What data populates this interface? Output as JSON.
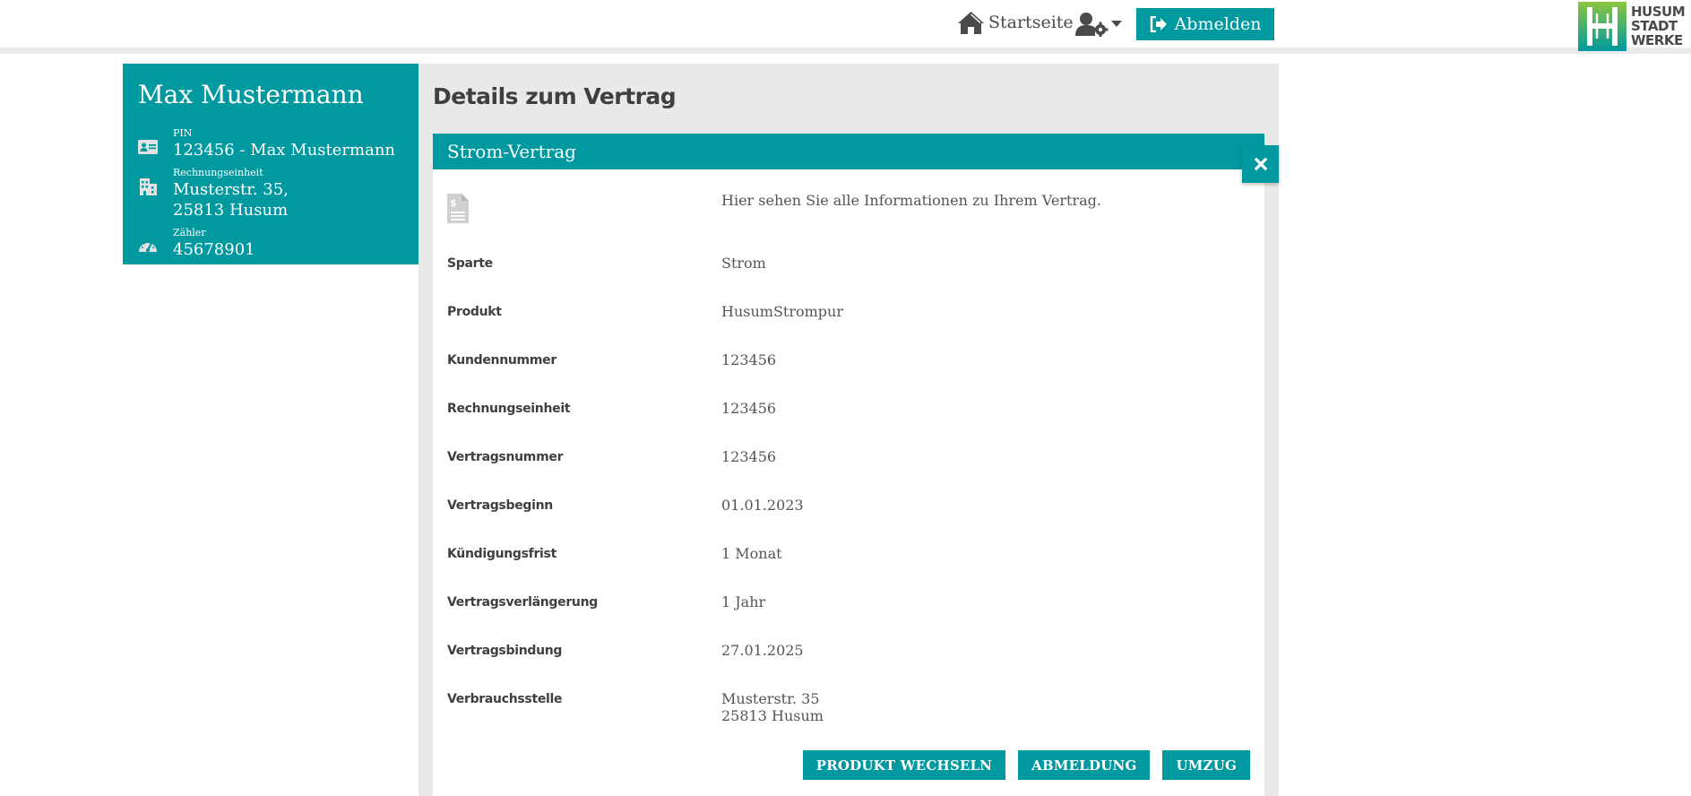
{
  "header": {
    "home_label": "Startseite",
    "logout_label": "Abmelden",
    "logo_lines": [
      "HUSUM",
      "STADT",
      "WERKE"
    ]
  },
  "profile": {
    "name": "Max Mustermann",
    "pin_label": "PIN",
    "pin_value": "123456 - Max Mustermann",
    "billing_label": "Rechnungseinheit",
    "billing_value": "Musterstr. 35,\n25813 Husum",
    "meter_label": "Zähler",
    "meter_value": "45678901"
  },
  "main": {
    "page_title": "Details zum Vertrag",
    "card_title": "Strom-Vertrag",
    "intro": "Hier sehen Sie alle Informationen zu Ihrem Vertrag.",
    "rows": [
      {
        "label": "Sparte",
        "value": "Strom"
      },
      {
        "label": "Produkt",
        "value": "HusumStrompur"
      },
      {
        "label": "Kundennummer",
        "value": "123456"
      },
      {
        "label": "Rechnungseinheit",
        "value": "123456"
      },
      {
        "label": "Vertragsnummer",
        "value": "123456"
      },
      {
        "label": "Vertragsbeginn",
        "value": "01.01.2023"
      },
      {
        "label": "Kündigungsfrist",
        "value": "1 Monat"
      },
      {
        "label": "Vertragsverlängerung",
        "value": "1 Jahr"
      },
      {
        "label": "Vertragsbindung",
        "value": "27.01.2025"
      },
      {
        "label": "Verbrauchsstelle",
        "value": "Musterstr. 35\n25813 Husum"
      }
    ],
    "actions": {
      "change_product": "PRODUKT WECHSELN",
      "cancel": "ABMELDUNG",
      "move": "UMZUG"
    }
  },
  "colors": {
    "accent": "#00999f",
    "panel_bg": "#e9e9e9",
    "logo_green": "#8cc63f"
  },
  "icons": [
    "home-icon",
    "user-settings-icon",
    "caret-down-icon",
    "sign-out-icon",
    "id-card-icon",
    "building-icon",
    "gauge-icon",
    "close-icon",
    "document-dollar-icon",
    "husum-logo-icon"
  ]
}
